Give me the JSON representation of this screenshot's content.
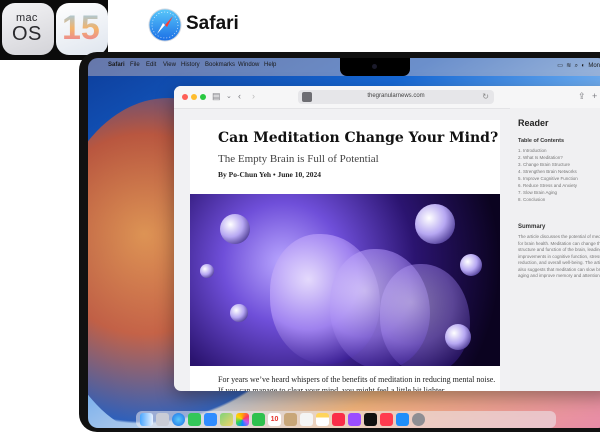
{
  "header": {
    "macos_small": "mac",
    "macos_large": "OS",
    "version": "15",
    "app_name": "Safari"
  },
  "menubar": {
    "items": [
      "Safari",
      "File",
      "Edit",
      "View",
      "History",
      "Bookmarks",
      "Window",
      "Help"
    ],
    "right_status": "Mon"
  },
  "browser": {
    "url": "thegranularnews.com"
  },
  "article": {
    "title": "Can Meditation Change Your Mind?",
    "subtitle": "The Empty Brain is Full of Potential",
    "byline": "By Po-Chun Yeh  •  June 10, 2024",
    "body": "For years we’ve heard whispers of the benefits of meditation in reducing mental noise. If you can manage to clear your mind, you might feel a little bit lighter"
  },
  "reader": {
    "title": "Reader",
    "toc_heading": "Table of Contents",
    "toc_items": [
      "1. Introduction",
      "2. What Is Meditation?",
      "3. Change Brain Structure",
      "4. Strengthen Brain Networks",
      "5. Improve Cognitive Function",
      "6. Reduce Stress and Anxiety",
      "7. Slow Brain Aging",
      "8. Conclusion"
    ],
    "summary_heading": "Summary",
    "summary_text": "The article discusses the potential of meditation for brain health. Meditation can change the structure and function of the brain, leading to improvements in cognitive function, stress reduction, and overall well-being. The article also suggests that meditation can slow brain aging and improve memory and attention."
  },
  "dock": {
    "icons": [
      "finder-icon",
      "launchpad-icon",
      "safari-icon",
      "messages-icon",
      "mail-icon",
      "maps-icon",
      "photos-icon",
      "facetime-icon",
      "calendar-icon",
      "contacts-icon",
      "reminders-icon",
      "notes-icon",
      "music-icon",
      "podcasts-icon",
      "tv-icon",
      "news-icon",
      "appstore-icon",
      "settings-icon"
    ],
    "calendar_day": "10"
  },
  "colors": {
    "traffic_red": "#fe5f57",
    "traffic_yellow": "#febc2e",
    "traffic_green": "#28c840"
  }
}
